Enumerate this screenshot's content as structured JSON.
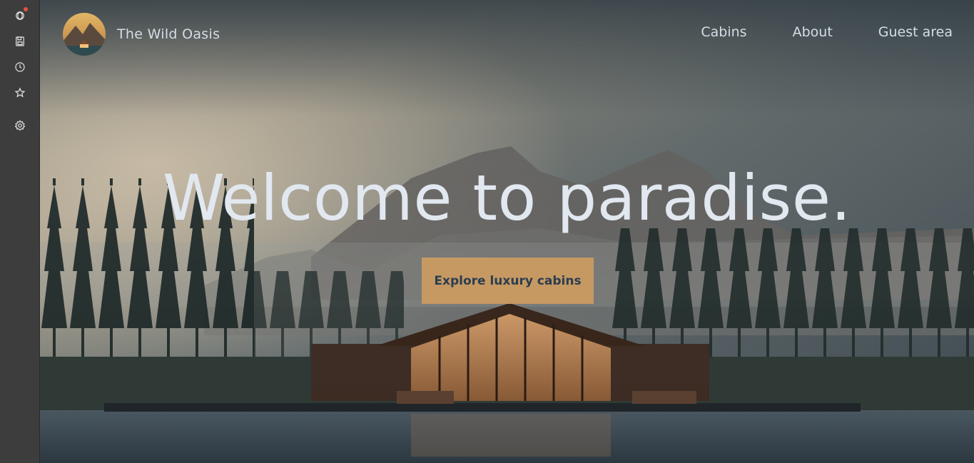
{
  "sidebar": {
    "items": [
      {
        "icon": "chatgpt-icon",
        "has_notification": true
      },
      {
        "icon": "save-icon"
      },
      {
        "icon": "clock-icon"
      },
      {
        "icon": "star-icon"
      },
      {
        "icon": "gear-icon"
      }
    ]
  },
  "header": {
    "brand": "The Wild Oasis",
    "nav": [
      {
        "label": "Cabins"
      },
      {
        "label": "About"
      },
      {
        "label": "Guest area"
      }
    ]
  },
  "hero": {
    "title": "Welcome to paradise.",
    "cta_label": "Explore luxury cabins"
  },
  "colors": {
    "accent": "#c69963",
    "cta_text": "#2c3d4f",
    "text_light": "#e2e8f0"
  }
}
